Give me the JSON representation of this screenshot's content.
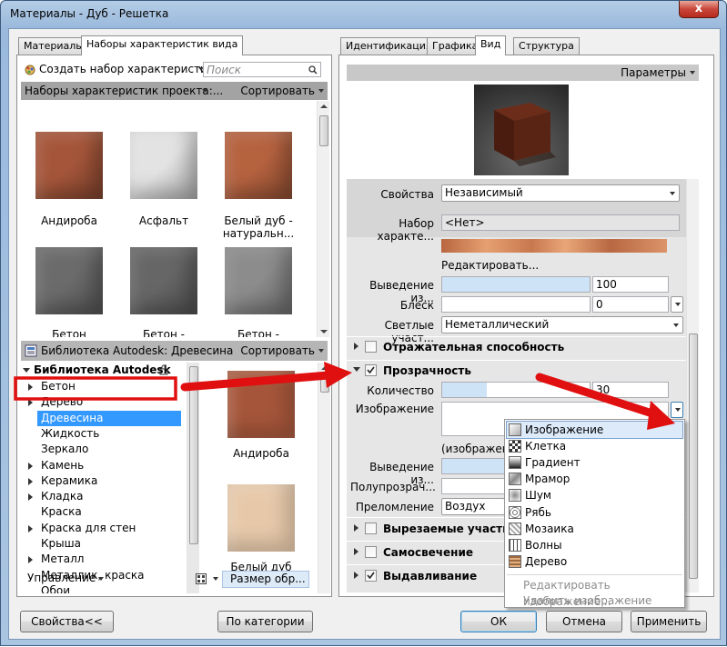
{
  "window": {
    "title": "Материалы - Дуб - Решетка",
    "close": "x"
  },
  "left_tabs": [
    "Материалы",
    "Наборы характеристик вида"
  ],
  "left_toolbar": {
    "create_label": "Создать набор характеристик",
    "search_placeholder": "Поиск"
  },
  "project_sets_bar": {
    "label": "Наборы характеристик проекта:...",
    "sort": "Сортировать"
  },
  "project_sets": [
    {
      "name": "Андироба",
      "color": "#a5563a"
    },
    {
      "name": "Асфальт",
      "color": "#e3e3e3"
    },
    {
      "name": "Белый дуб - натуральн...",
      "color": "#b5623f"
    },
    {
      "name": "Бетон",
      "color": "#6b6b6b"
    },
    {
      "name": "Бетон -",
      "color": "#666666"
    },
    {
      "name": "Бетон -",
      "color": "#8c8c8c"
    }
  ],
  "library_bar": {
    "label": "Библиотека Autodesk: Древесина",
    "sort": "Сортировать"
  },
  "library_tree": {
    "root": "Библиотека Autodesk",
    "items": [
      {
        "label": "Бетон",
        "expandable": true,
        "selected": false
      },
      {
        "label": "Дерево",
        "expandable": true,
        "selected": false
      },
      {
        "label": "Древесина",
        "expandable": false,
        "selected": true
      },
      {
        "label": "Жидкость",
        "expandable": false,
        "selected": false
      },
      {
        "label": "Зеркало",
        "expandable": false,
        "selected": false
      },
      {
        "label": "Камень",
        "expandable": true,
        "selected": false
      },
      {
        "label": "Керамика",
        "expandable": true,
        "selected": false
      },
      {
        "label": "Кладка",
        "expandable": true,
        "selected": false
      },
      {
        "label": "Краска",
        "expandable": false,
        "selected": false
      },
      {
        "label": "Краска для стен",
        "expandable": true,
        "selected": false
      },
      {
        "label": "Крыша",
        "expandable": false,
        "selected": false
      },
      {
        "label": "Металл",
        "expandable": true,
        "selected": false
      },
      {
        "label": "Металлик, краска",
        "expandable": false,
        "selected": false
      },
      {
        "label": "Обои",
        "expandable": false,
        "selected": false
      }
    ]
  },
  "library_items": [
    {
      "name": "Андироба",
      "color": "#a5563a"
    },
    {
      "name": "Белый дуб",
      "color": "#e7c9aa"
    }
  ],
  "left_bottom": {
    "manage": "Управление",
    "size": "Размер обр..."
  },
  "right_tabs": [
    "Идентификация",
    "Графика",
    "Вид",
    "Структура"
  ],
  "params_label": "Параметры",
  "props": {
    "svojstva_label": "Свойства",
    "svojstva_value": "Независимый",
    "nabor_label": "Набор характе...",
    "nabor_value": "<Нет>",
    "edit_link": "Редактировать...",
    "vyvedenie_label": "Выведение из...",
    "vyvedenie_value": "100",
    "blesk_label": "Блеск",
    "blesk_value": "0",
    "svetlye_label": "Светлые участ...",
    "svetlye_value": "Неметаллический",
    "otr_label": "Отражательная способность",
    "prozr_label": "Прозрачность",
    "kol_label": "Количество",
    "kol_value": "30",
    "izobr_label": "Изображение",
    "izobr_caption": "(изображени",
    "vyvedenie2_label": "Выведение из...",
    "polu_label": "Полупрозрач...",
    "prelom_label": "Преломление",
    "prelom_value": "Воздух",
    "vyrez_label": "Вырезаемые участки",
    "samosv_label": "Самосвечение",
    "vydav_label": "Выдавливание"
  },
  "dropdown": {
    "items": [
      "Изображение",
      "Клетка",
      "Градиент",
      "Мрамор",
      "Шум",
      "Рябь",
      "Мозаика",
      "Волны",
      "Дерево"
    ],
    "disabled": [
      "Редактировать изображение...",
      "Удалить изображение"
    ]
  },
  "buttons": {
    "props": "Свойства<<",
    "by_cat": "По категории",
    "ok": "ОК",
    "cancel": "Отмена",
    "apply": "Применить"
  },
  "colors": {
    "highlight_red": "#e01010",
    "accent_blue": "#3399ff"
  }
}
